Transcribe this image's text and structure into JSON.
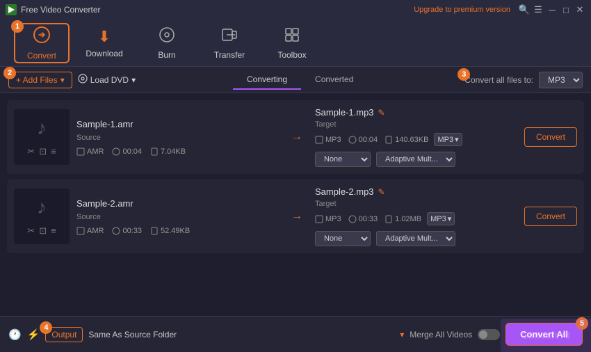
{
  "app": {
    "title": "Free Video Converter",
    "upgrade_link": "Upgrade to premium version"
  },
  "toolbar": {
    "items": [
      {
        "id": "convert",
        "label": "Convert",
        "icon": "↻",
        "active": true,
        "badge": "1"
      },
      {
        "id": "download",
        "label": "Download",
        "icon": "⬇",
        "active": false
      },
      {
        "id": "burn",
        "label": "Burn",
        "icon": "⊙",
        "active": false
      },
      {
        "id": "transfer",
        "label": "Transfer",
        "icon": "⇄",
        "active": false
      },
      {
        "id": "toolbox",
        "label": "Toolbox",
        "icon": "⊞",
        "active": false
      }
    ]
  },
  "action_bar": {
    "add_files_label": "+ Add Files",
    "add_files_badge": "2",
    "load_dvd_label": "Load DVD",
    "tabs": [
      {
        "id": "converting",
        "label": "Converting",
        "active": true
      },
      {
        "id": "converted",
        "label": "Converted",
        "active": false
      }
    ],
    "convert_all_files_label": "Convert all files to:",
    "convert_all_files_badge": "3",
    "format": "MP3"
  },
  "files": [
    {
      "id": "file1",
      "thumbnail_icon": "♪",
      "name": "Sample-1.amr",
      "source_format": "AMR",
      "source_duration": "00:04",
      "source_size": "7.04KB",
      "target_name": "Sample-1.mp3",
      "target_format": "MP3",
      "target_duration": "00:04",
      "target_size": "140.63KB",
      "effect1": "None",
      "effect2": "Adaptive Mult...",
      "convert_label": "Convert"
    },
    {
      "id": "file2",
      "thumbnail_icon": "♪",
      "name": "Sample-2.amr",
      "source_format": "AMR",
      "source_duration": "00:33",
      "source_size": "52.49KB",
      "target_name": "Sample-2.mp3",
      "target_format": "MP3",
      "target_duration": "00:33",
      "target_size": "1.02MB",
      "effect1": "None",
      "effect2": "Adaptive Mult...",
      "convert_label": "Convert"
    }
  ],
  "bottom_bar": {
    "output_label": "Output",
    "output_badge": "4",
    "output_path": "Same As Source Folder",
    "merge_label": "Merge All Videos",
    "convert_all_label": "Convert All",
    "convert_all_badge": "5"
  },
  "watermark": {
    "text": "Convert AI"
  }
}
